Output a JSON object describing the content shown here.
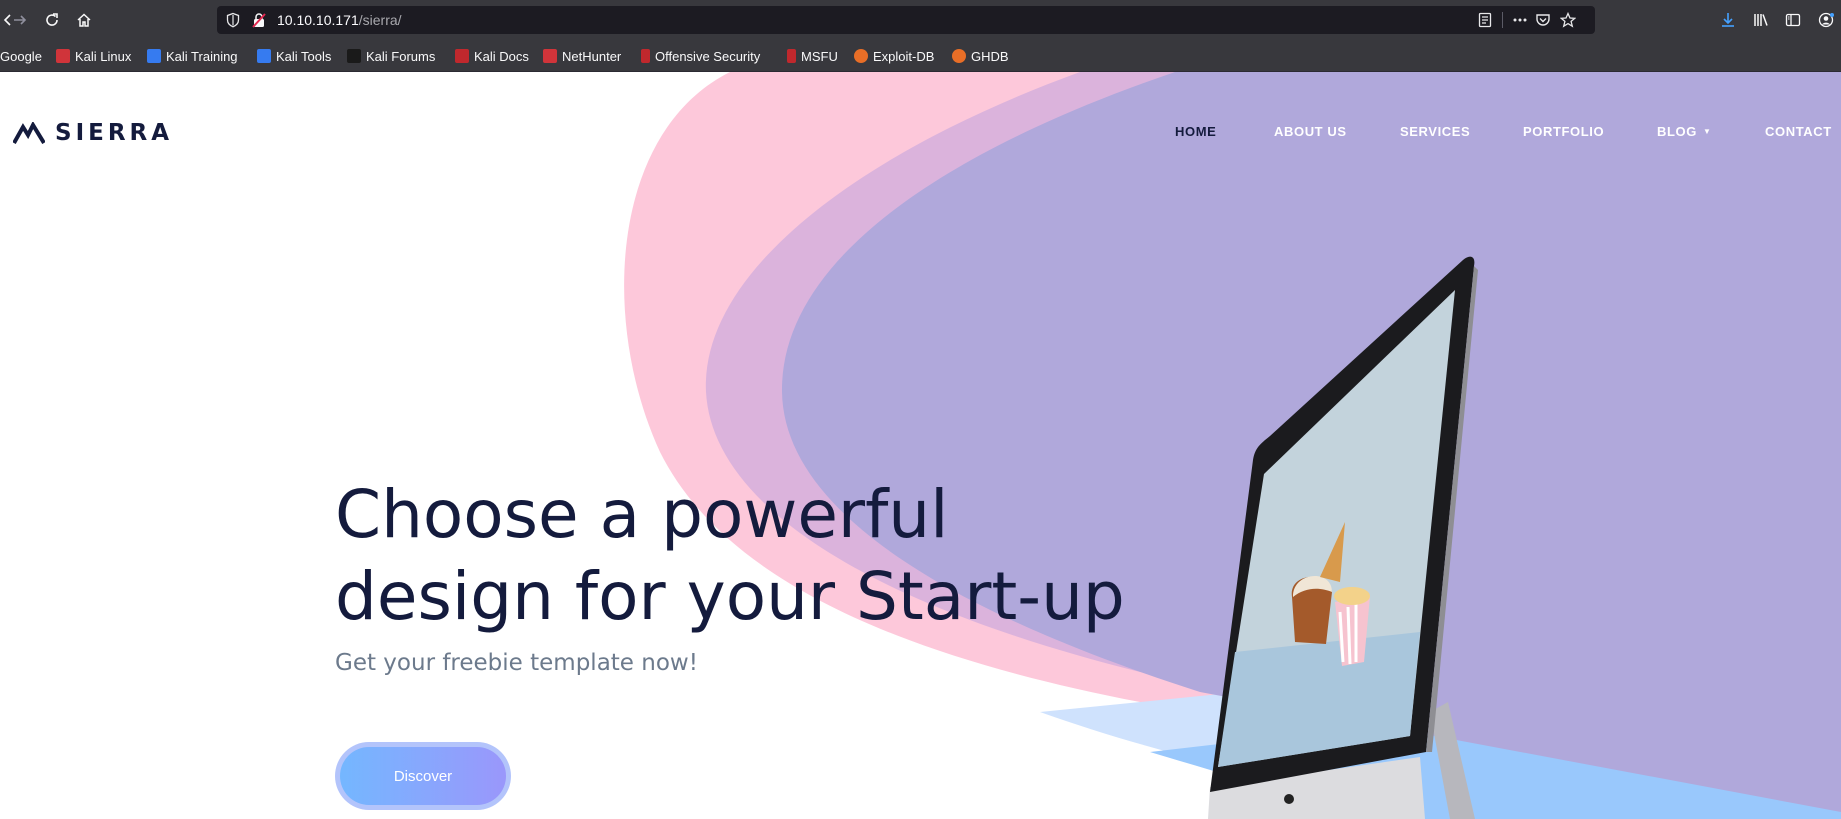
{
  "browser": {
    "url_host": "10.10.10.171",
    "url_path": "/sierra/",
    "icons": [
      "back-icon",
      "forward-icon",
      "reload-icon",
      "home-icon",
      "shield-icon",
      "insecure-lock-icon",
      "reader-view-icon",
      "page-actions-icon",
      "pocket-icon",
      "bookmark-star-icon",
      "download-icon",
      "library-icon",
      "sidebar-icon",
      "account-icon"
    ]
  },
  "bookmarks": [
    {
      "label": "Google",
      "color": "#4285f4"
    },
    {
      "label": "Kali Linux",
      "color": "#d0343a"
    },
    {
      "label": "Kali Training",
      "color": "#367bf0"
    },
    {
      "label": "Kali Tools",
      "color": "#367bf0"
    },
    {
      "label": "Kali Forums",
      "color": "#1a1a1a"
    },
    {
      "label": "Kali Docs",
      "color": "#c0282d"
    },
    {
      "label": "NetHunter",
      "color": "#d0343a"
    },
    {
      "label": "Offensive Security",
      "color": "#c0282d"
    },
    {
      "label": "MSFU",
      "color": "#c0282d"
    },
    {
      "label": "Exploit-DB",
      "color": "#e86e27"
    },
    {
      "label": "GHDB",
      "color": "#e86e27"
    }
  ],
  "site": {
    "logo_text": "SIERRA",
    "nav": {
      "home": "HOME",
      "about": "ABOUT US",
      "services": "SERVICES",
      "portfolio": "PORTFOLIO",
      "blog": "BLOG",
      "contact": "CONTACT"
    },
    "hero": {
      "title_line1": "Choose a powerful",
      "title_line2": "design for your Start-up",
      "subtitle": "Get your freebie template now!",
      "button": "Discover"
    }
  },
  "colors": {
    "chrome": "#38383d",
    "urlbar": "#1c1b22",
    "navy": "#141b3d",
    "lavender": "#b0a8db",
    "pink": "#fdc8da",
    "light_blue": "#99c8fc",
    "subtitle": "#6c7a8c"
  }
}
